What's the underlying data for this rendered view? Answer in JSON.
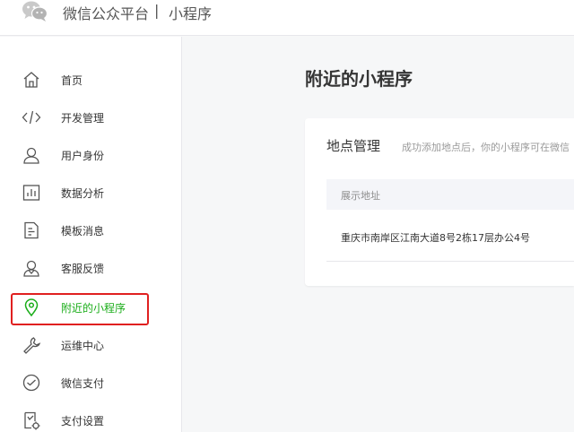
{
  "header": {
    "app_name": "微信公众平台",
    "separator": "|",
    "section": "小程序"
  },
  "sidebar": {
    "items": [
      {
        "label": "首页",
        "icon": "home-icon"
      },
      {
        "label": "开发管理",
        "icon": "code-icon"
      },
      {
        "label": "用户身份",
        "icon": "user-icon"
      },
      {
        "label": "数据分析",
        "icon": "bar-chart-icon"
      },
      {
        "label": "模板消息",
        "icon": "document-icon"
      },
      {
        "label": "客服反馈",
        "icon": "customer-service-icon"
      },
      {
        "label": "附近的小程序",
        "icon": "location-pin-icon",
        "active": true
      },
      {
        "label": "运维中心",
        "icon": "wrench-icon"
      },
      {
        "label": "微信支付",
        "icon": "payment-icon"
      },
      {
        "label": "支付设置",
        "icon": "payment-settings-icon"
      }
    ]
  },
  "main": {
    "title": "附近的小程序",
    "panel": {
      "title": "地点管理",
      "tip": "成功添加地点后，你的小程序可在微信",
      "column_header": "展示地址",
      "rows": [
        {
          "address": "重庆市南岸区江南大道8号2栋17层办公4号"
        }
      ]
    }
  },
  "colors": {
    "accent": "#1aad19",
    "highlight_box": "#e02020"
  }
}
